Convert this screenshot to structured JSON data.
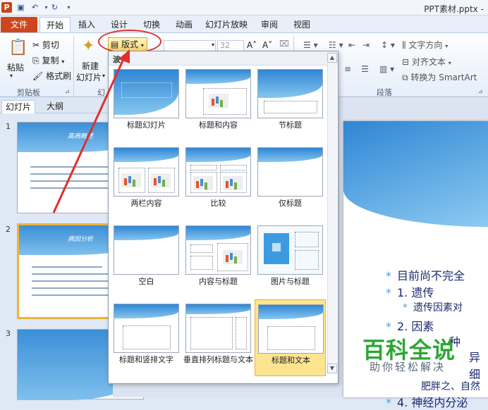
{
  "titlebar": {
    "app_icon": "P",
    "save_icon": "save-icon",
    "undo_icon": "undo-icon",
    "redo_icon": "redo-icon",
    "title": "PPT素材.pptx -"
  },
  "tabs": [
    "文件",
    "开始",
    "插入",
    "设计",
    "切换",
    "动画",
    "幻灯片放映",
    "审阅",
    "视图"
  ],
  "ribbon": {
    "paste": "粘贴",
    "cut": "剪切",
    "copy": "复制",
    "format_painter": "格式刷",
    "clipboard_group": "剪贴板",
    "new_slide_1": "新建",
    "new_slide_2": "幻灯片",
    "slides_group_partial": "幻",
    "layout_btn": "版式",
    "font_size": "32",
    "text_direction": "文字方向",
    "align_text": "对齐文本",
    "convert_smartart": "转换为 SmartArt",
    "paragraph_group": "段落"
  },
  "panel_tabs": [
    "幻灯片",
    "大纲"
  ],
  "slides": [
    {
      "num": "1",
      "title": "高病概述"
    },
    {
      "num": "2",
      "title": "病因分析"
    },
    {
      "num": "3",
      "title": ""
    }
  ],
  "dropdown": {
    "header": "波",
    "layouts": [
      "标题幻灯片",
      "标题和内容",
      "节标题",
      "两栏内容",
      "比较",
      "仅标题",
      "空白",
      "内容与标题",
      "图片与标题",
      "标题和竖排文字",
      "垂直排列标题与文本",
      "标题和文本"
    ],
    "selected": "标题和文本"
  },
  "slide_main": {
    "line1": "目前尚不完全",
    "line2": "1. 遗传",
    "line3": "遗传因素对",
    "line4": "2. 因素",
    "line5": "种",
    "line6": "异",
    "line7": "细",
    "line8": "肥胖之、自然",
    "line9": "4. 神经内分泌"
  },
  "watermark": {
    "title": "百科全说",
    "subtitle": "助你轻松解决"
  },
  "colors": {
    "file_tab": "#d0461c",
    "highlight": "#e0302e",
    "selected_tile": "#fde490",
    "watermark": "#2ea636"
  }
}
